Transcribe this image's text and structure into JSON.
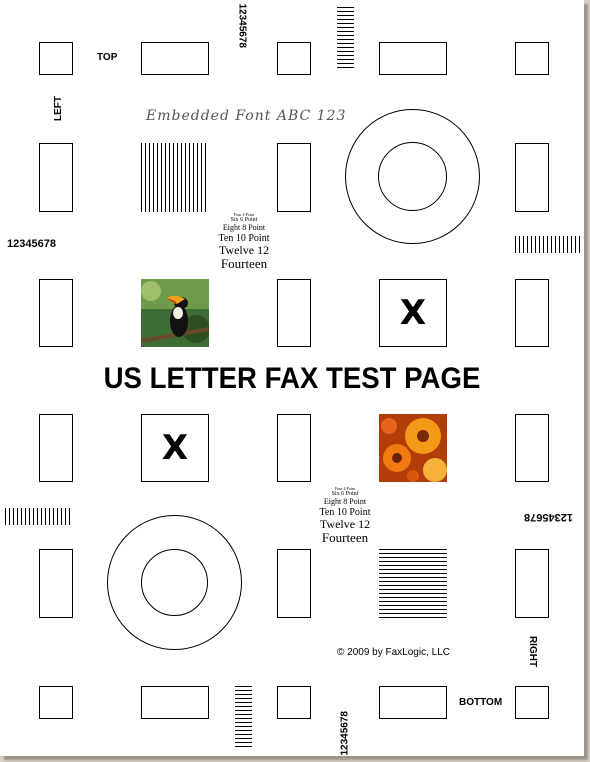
{
  "page": {
    "title": "US LETTER FAX TEST PAGE",
    "embedded_font_sample": "Embedded Font ABC 123",
    "copyright": "© 2009 by FaxLogic, LLC"
  },
  "edge_labels": {
    "top": "TOP",
    "left": "LEFT",
    "right": "RIGHT",
    "bottom": "BOTTOM"
  },
  "digit_strings": {
    "top": "12345678",
    "left": "12345678",
    "right": "12345678",
    "bottom": "12345678"
  },
  "font_samples_upper": [
    "Four 4 Point",
    "Six 6 Point",
    "Eight 8 Point",
    "Ten 10 Point",
    "Twelve 12",
    "Fourteen"
  ],
  "font_samples_lower": [
    "Four 4 Point",
    "Six 6 Point",
    "Eight 8 Point",
    "Ten 10 Point",
    "Twelve 12",
    "Fourteen"
  ],
  "x_marks": {
    "upper": "X",
    "lower": "X"
  },
  "images": {
    "upper": "toucan-photo",
    "lower": "orange-flowers-photo"
  }
}
